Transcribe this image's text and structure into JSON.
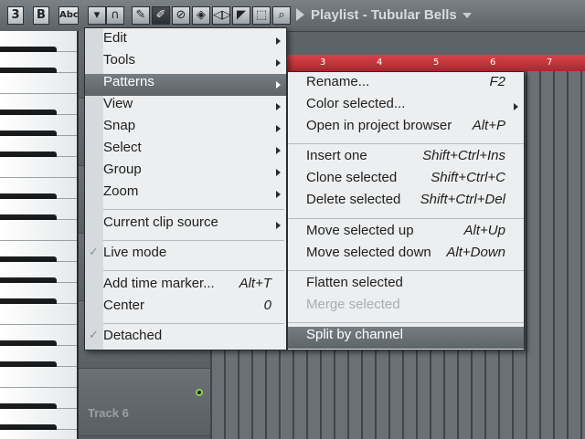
{
  "toolbar": {
    "buttons": [
      "3",
      "B",
      "Abc"
    ],
    "playlist_title": "Playlist - Tubular Bells"
  },
  "ruler": {
    "marks": [
      "3",
      "4",
      "5",
      "6",
      "7"
    ]
  },
  "tracks": {
    "track6": "Track 6"
  },
  "menu": {
    "items": [
      {
        "label": "Edit",
        "has_sub": true
      },
      {
        "label": "Tools",
        "has_sub": true
      },
      {
        "label": "Patterns",
        "has_sub": true,
        "highlighted": true
      },
      {
        "label": "View",
        "has_sub": true
      },
      {
        "label": "Snap",
        "has_sub": true
      },
      {
        "label": "Select",
        "has_sub": true
      },
      {
        "label": "Group",
        "has_sub": true
      },
      {
        "label": "Zoom",
        "has_sub": true
      },
      {
        "label": "Current clip source",
        "has_sub": true
      },
      {
        "label": "Live mode",
        "checked": true
      },
      {
        "label": "Add time marker...",
        "shortcut": "Alt+T"
      },
      {
        "label": "Center",
        "shortcut": "0"
      },
      {
        "label": "Detached",
        "checked": true
      }
    ]
  },
  "submenu": {
    "items": [
      {
        "label": "Rename...",
        "shortcut": "F2"
      },
      {
        "label": "Color selected...",
        "has_sub": true
      },
      {
        "label": "Open in project browser",
        "shortcut": "Alt+P"
      },
      {
        "label": "Insert one",
        "shortcut": "Shift+Ctrl+Ins"
      },
      {
        "label": "Clone selected",
        "shortcut": "Shift+Ctrl+C"
      },
      {
        "label": "Delete selected",
        "shortcut": "Shift+Ctrl+Del"
      },
      {
        "label": "Move selected up",
        "shortcut": "Alt+Up"
      },
      {
        "label": "Move selected down",
        "shortcut": "Alt+Down"
      },
      {
        "label": "Flatten selected"
      },
      {
        "label": "Merge selected",
        "disabled": true
      },
      {
        "label": "Split by channel",
        "highlighted": true
      }
    ]
  },
  "colors": {
    "ruler": "#c7353c",
    "highlight": "#6a7176",
    "menu_bg": "#edeeef"
  }
}
